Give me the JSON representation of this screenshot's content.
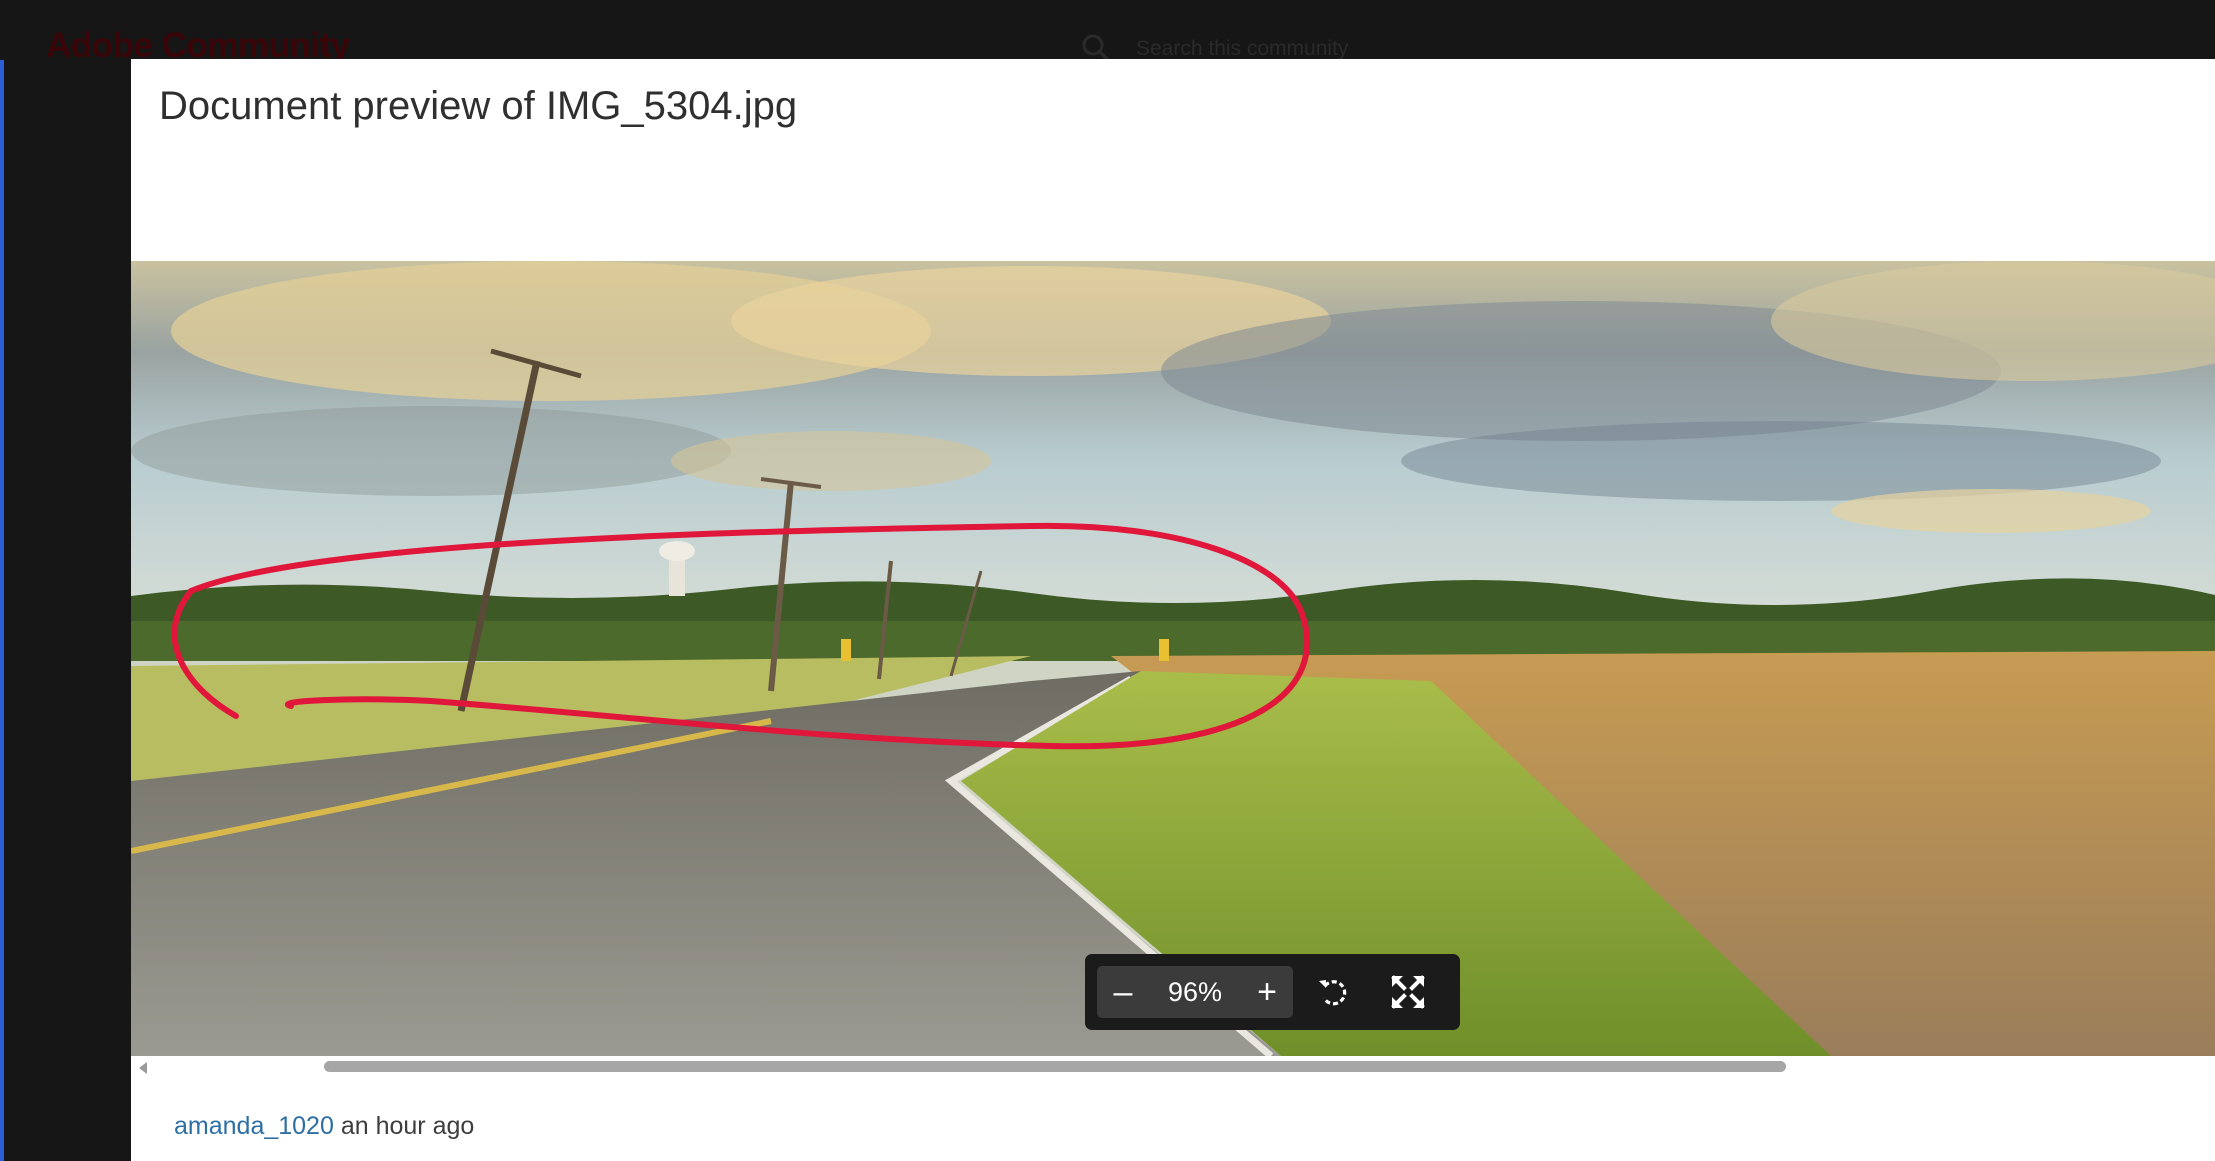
{
  "site": {
    "logo_text": "Adobe Community",
    "search": {
      "icon": "search-icon",
      "placeholder": "Search this community"
    }
  },
  "modal": {
    "title": "Document preview of IMG_5304.jpg"
  },
  "viewer": {
    "image_description_icon": "photo",
    "toolbar": {
      "zoom_out_label": "–",
      "zoom_level": "96%",
      "zoom_in_label": "+",
      "rotate_icon": "rotate-icon",
      "fullscreen_icon": "fullscreen-icon"
    }
  },
  "post": {
    "author": "amanda_1020",
    "time": "an hour ago"
  },
  "colors": {
    "accent": "#2c5fd6",
    "link": "#2d6fa3",
    "annotation": "#e0173b",
    "toolbar_bg": "#1b1b1b"
  }
}
